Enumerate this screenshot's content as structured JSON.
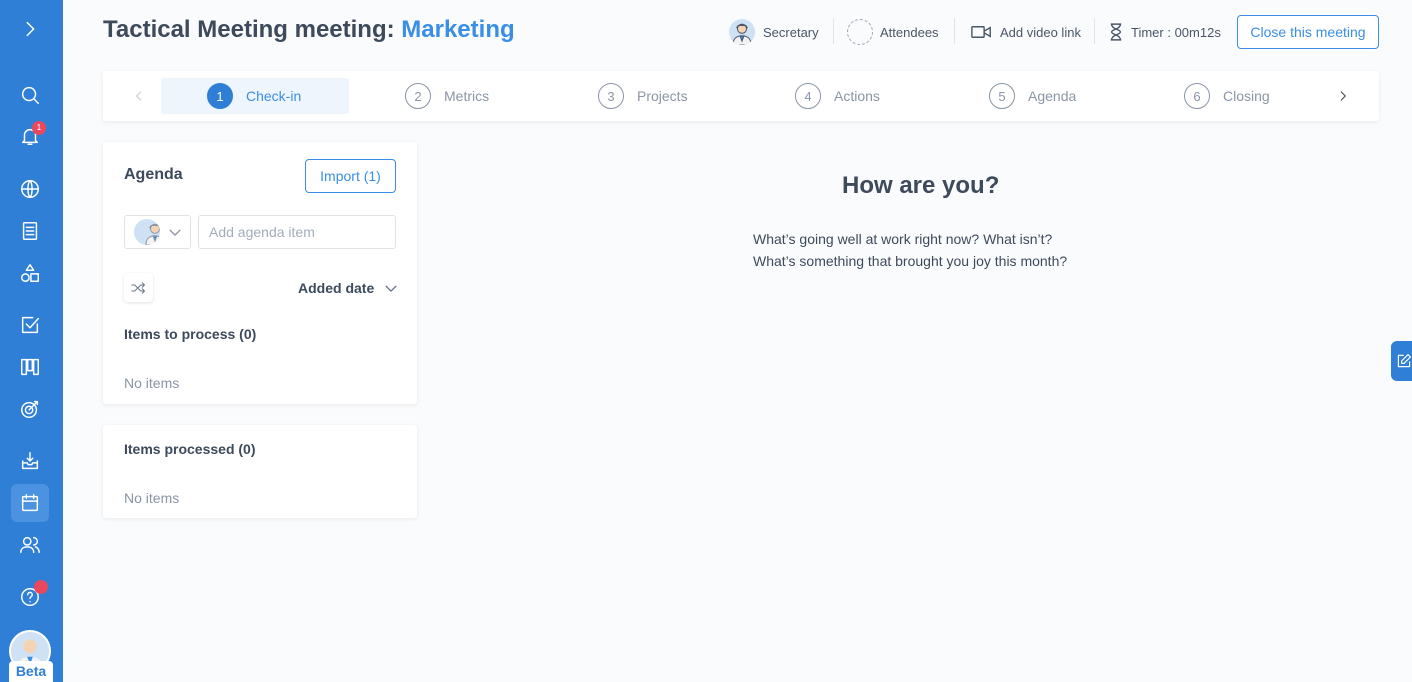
{
  "header": {
    "title_prefix": "Tactical Meeting meeting:",
    "title_accent": "Marketing",
    "secretary_label": "Secretary",
    "attendees_label": "Attendees",
    "video_label": "Add video link",
    "timer_label": "Timer : 00m12s",
    "close_label": "Close this meeting"
  },
  "sidebar": {
    "items": [
      {
        "icon": "chevron-right-icon"
      },
      {
        "icon": "search-icon"
      },
      {
        "icon": "bell-icon",
        "badge": "1"
      },
      {
        "icon": "globe-icon"
      },
      {
        "icon": "document-icon"
      },
      {
        "icon": "shapes-icon"
      },
      {
        "icon": "checkbox-icon"
      },
      {
        "icon": "kanban-icon"
      },
      {
        "icon": "target-icon"
      },
      {
        "icon": "inbox-icon"
      },
      {
        "icon": "calendar-icon",
        "active": true
      },
      {
        "icon": "users-icon"
      },
      {
        "icon": "help-icon"
      }
    ],
    "beta_label": "Beta"
  },
  "stepper": {
    "steps": [
      {
        "num": "1",
        "label": "Check-in",
        "active": true
      },
      {
        "num": "2",
        "label": "Metrics"
      },
      {
        "num": "3",
        "label": "Projects"
      },
      {
        "num": "4",
        "label": "Actions"
      },
      {
        "num": "5",
        "label": "Agenda"
      },
      {
        "num": "6",
        "label": "Closing"
      }
    ]
  },
  "agenda": {
    "title": "Agenda",
    "import_label": "Import (1)",
    "input_placeholder": "Add agenda item",
    "sort_label": "Added date",
    "to_process_label": "Items to process (0)",
    "to_process_empty": "No items",
    "processed_label": "Items processed (0)",
    "processed_empty": "No items"
  },
  "checkin": {
    "heading": "How are you?",
    "line1": "What’s going well at work right now? What isn’t?",
    "line2": "What’s something that brought you joy this month?"
  },
  "colors": {
    "sidebar": "#2f7fd6",
    "accent": "#3a8ee6",
    "badge": "#e8495f"
  }
}
